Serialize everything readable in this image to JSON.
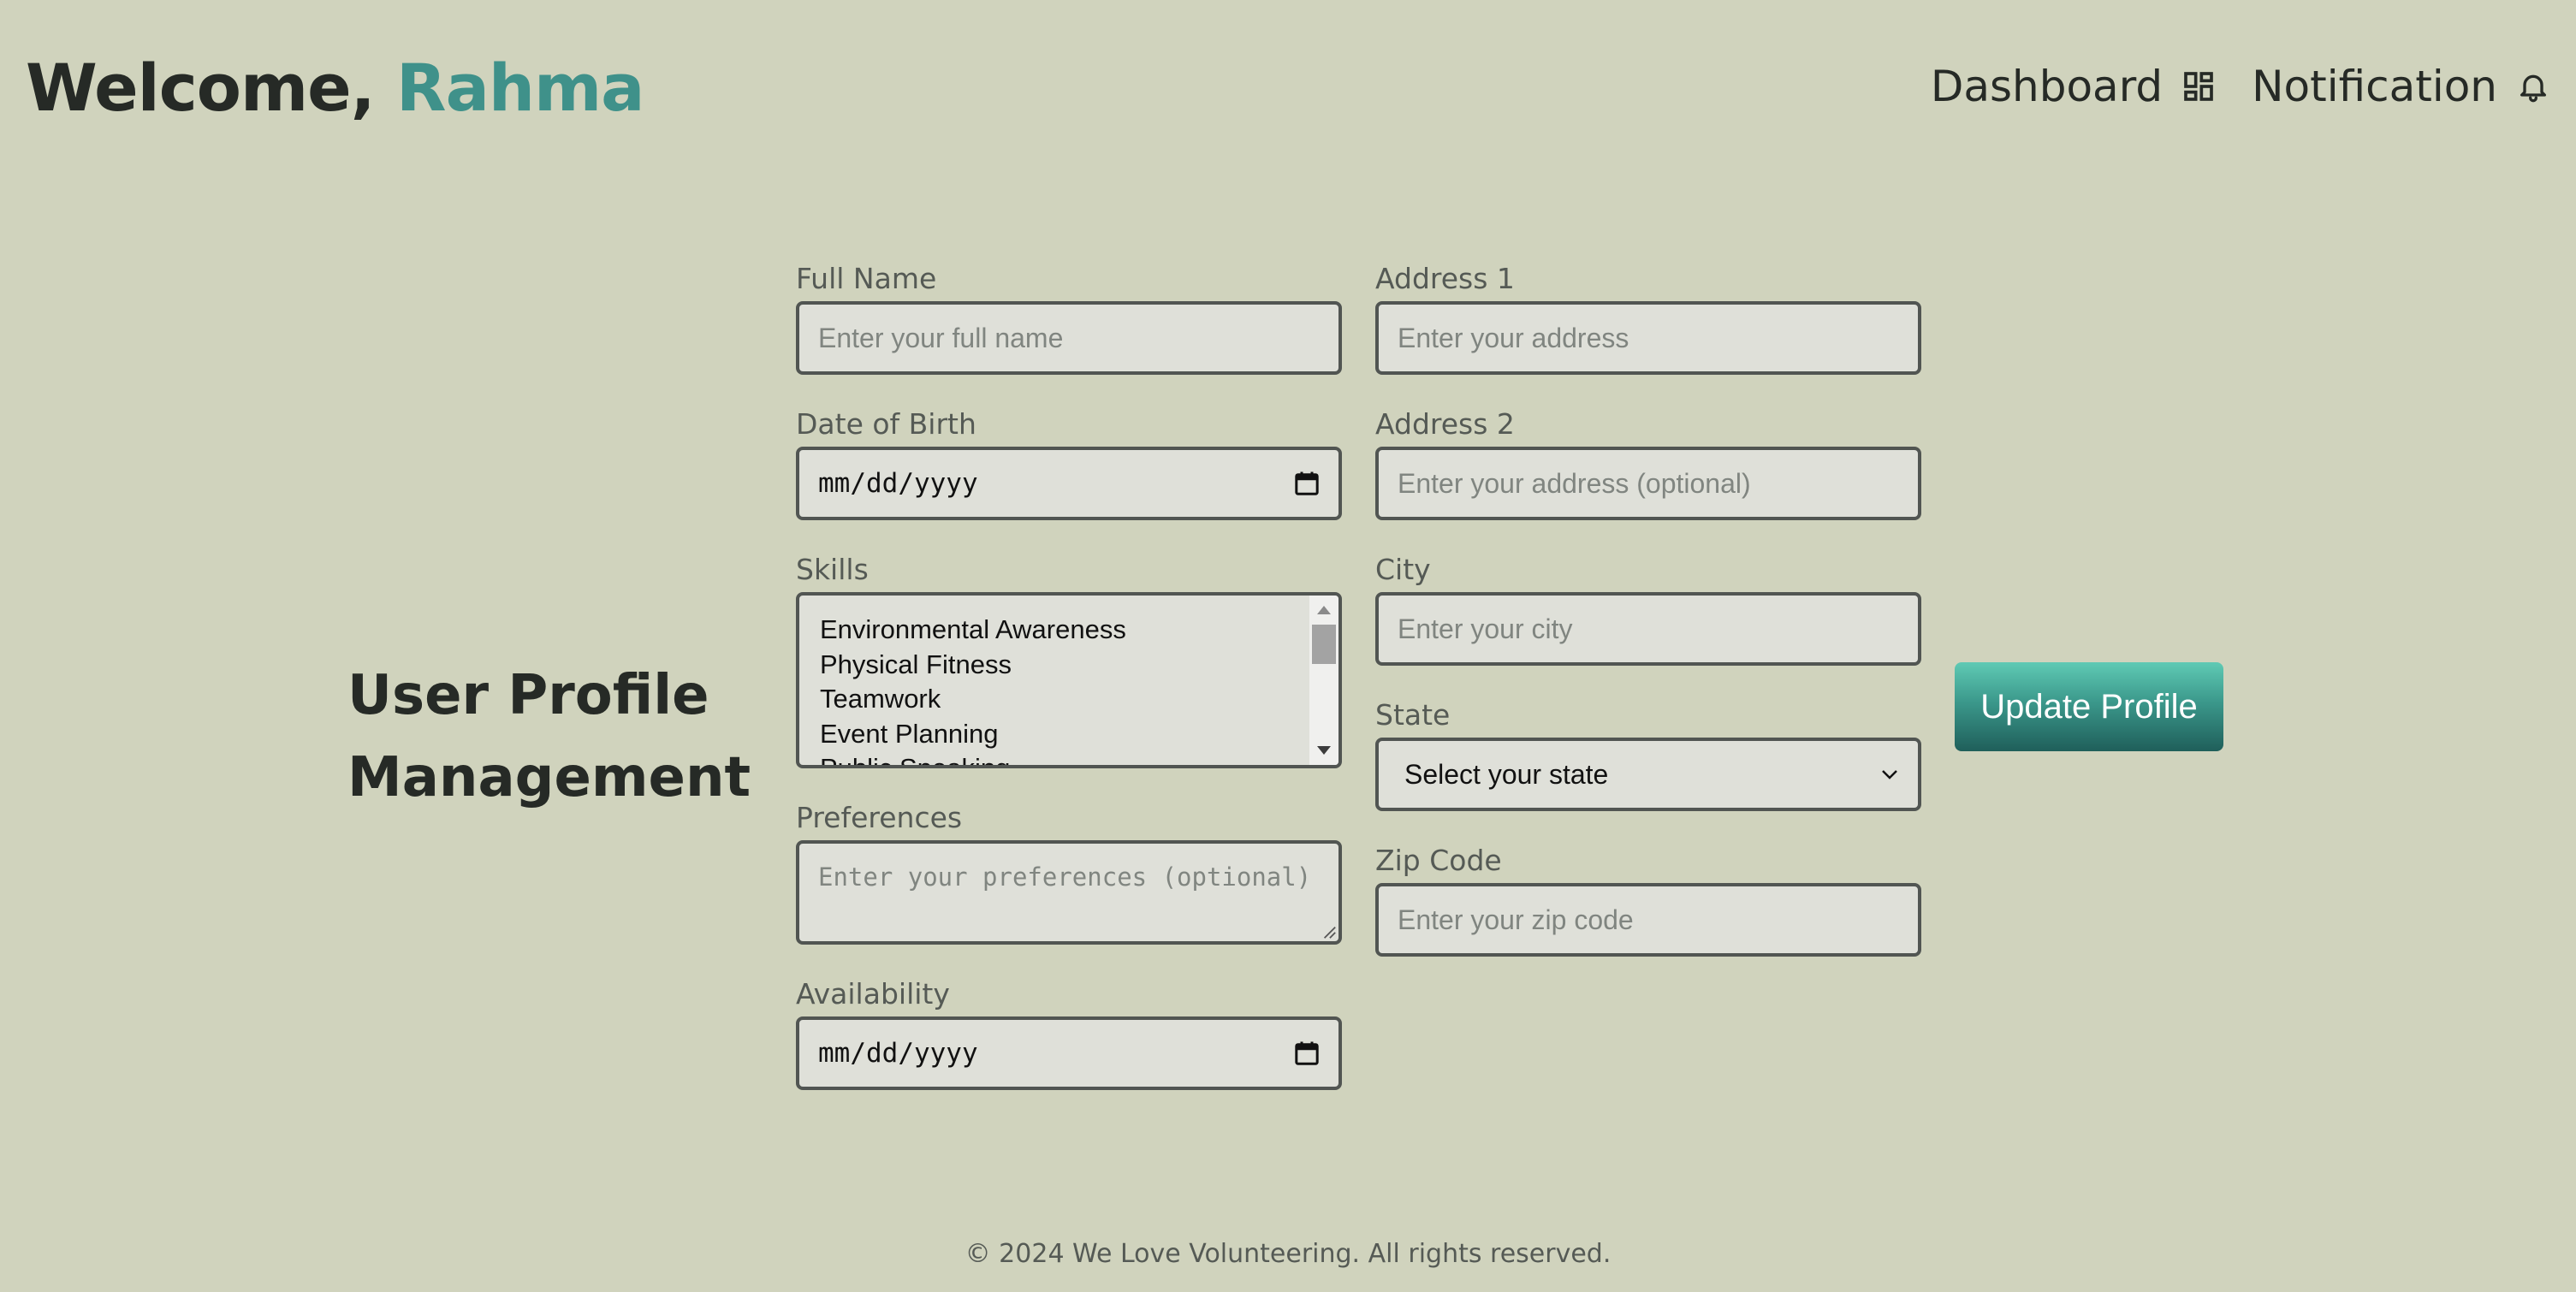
{
  "header": {
    "welcome_prefix": "Welcome, ",
    "user_name": "Rahma",
    "nav": [
      {
        "label": "Dashboard",
        "icon": "dashboard-icon"
      },
      {
        "label": "Notification",
        "icon": "bell-icon"
      }
    ]
  },
  "page_title_line1": "User Profile",
  "page_title_line2": "Management",
  "form": {
    "full_name": {
      "label": "Full Name",
      "placeholder": "Enter your full name"
    },
    "dob": {
      "label": "Date of Birth",
      "value": "mm/dd/yyyy"
    },
    "skills": {
      "label": "Skills",
      "options": [
        "Environmental Awareness",
        "Physical Fitness",
        "Teamwork",
        "Event Planning",
        "Public Speaking"
      ]
    },
    "preferences": {
      "label": "Preferences",
      "placeholder": "Enter your preferences (optional)"
    },
    "availability": {
      "label": "Availability",
      "value": "mm/dd/yyyy"
    },
    "address1": {
      "label": "Address 1",
      "placeholder": "Enter your address"
    },
    "address2": {
      "label": "Address 2",
      "placeholder": "Enter your address (optional)"
    },
    "city": {
      "label": "City",
      "placeholder": "Enter your city"
    },
    "state": {
      "label": "State",
      "selected": "Select your state"
    },
    "zip": {
      "label": "Zip Code",
      "placeholder": "Enter your zip code"
    },
    "submit_label": "Update Profile"
  },
  "footer": {
    "text": "© 2024 We Love Volunteering. All rights reserved."
  },
  "colors": {
    "background": "#d0d3bd",
    "accent": "#3f918a",
    "field_bg": "#dfe0d9",
    "button_top": "#5fcab4",
    "button_bottom": "#1f5f5a"
  }
}
